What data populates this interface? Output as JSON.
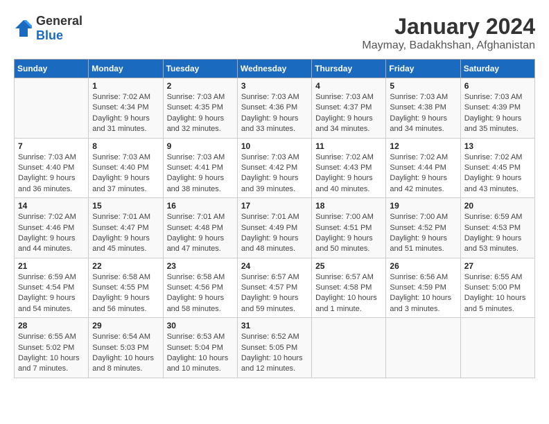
{
  "header": {
    "logo_general": "General",
    "logo_blue": "Blue",
    "month_title": "January 2024",
    "location": "Maymay, Badakhshan, Afghanistan"
  },
  "weekdays": [
    "Sunday",
    "Monday",
    "Tuesday",
    "Wednesday",
    "Thursday",
    "Friday",
    "Saturday"
  ],
  "weeks": [
    [
      {
        "day": "",
        "info": ""
      },
      {
        "day": "1",
        "info": "Sunrise: 7:02 AM\nSunset: 4:34 PM\nDaylight: 9 hours\nand 31 minutes."
      },
      {
        "day": "2",
        "info": "Sunrise: 7:03 AM\nSunset: 4:35 PM\nDaylight: 9 hours\nand 32 minutes."
      },
      {
        "day": "3",
        "info": "Sunrise: 7:03 AM\nSunset: 4:36 PM\nDaylight: 9 hours\nand 33 minutes."
      },
      {
        "day": "4",
        "info": "Sunrise: 7:03 AM\nSunset: 4:37 PM\nDaylight: 9 hours\nand 34 minutes."
      },
      {
        "day": "5",
        "info": "Sunrise: 7:03 AM\nSunset: 4:38 PM\nDaylight: 9 hours\nand 34 minutes."
      },
      {
        "day": "6",
        "info": "Sunrise: 7:03 AM\nSunset: 4:39 PM\nDaylight: 9 hours\nand 35 minutes."
      }
    ],
    [
      {
        "day": "7",
        "info": "Sunrise: 7:03 AM\nSunset: 4:40 PM\nDaylight: 9 hours\nand 36 minutes."
      },
      {
        "day": "8",
        "info": "Sunrise: 7:03 AM\nSunset: 4:40 PM\nDaylight: 9 hours\nand 37 minutes."
      },
      {
        "day": "9",
        "info": "Sunrise: 7:03 AM\nSunset: 4:41 PM\nDaylight: 9 hours\nand 38 minutes."
      },
      {
        "day": "10",
        "info": "Sunrise: 7:03 AM\nSunset: 4:42 PM\nDaylight: 9 hours\nand 39 minutes."
      },
      {
        "day": "11",
        "info": "Sunrise: 7:02 AM\nSunset: 4:43 PM\nDaylight: 9 hours\nand 40 minutes."
      },
      {
        "day": "12",
        "info": "Sunrise: 7:02 AM\nSunset: 4:44 PM\nDaylight: 9 hours\nand 42 minutes."
      },
      {
        "day": "13",
        "info": "Sunrise: 7:02 AM\nSunset: 4:45 PM\nDaylight: 9 hours\nand 43 minutes."
      }
    ],
    [
      {
        "day": "14",
        "info": "Sunrise: 7:02 AM\nSunset: 4:46 PM\nDaylight: 9 hours\nand 44 minutes."
      },
      {
        "day": "15",
        "info": "Sunrise: 7:01 AM\nSunset: 4:47 PM\nDaylight: 9 hours\nand 45 minutes."
      },
      {
        "day": "16",
        "info": "Sunrise: 7:01 AM\nSunset: 4:48 PM\nDaylight: 9 hours\nand 47 minutes."
      },
      {
        "day": "17",
        "info": "Sunrise: 7:01 AM\nSunset: 4:49 PM\nDaylight: 9 hours\nand 48 minutes."
      },
      {
        "day": "18",
        "info": "Sunrise: 7:00 AM\nSunset: 4:51 PM\nDaylight: 9 hours\nand 50 minutes."
      },
      {
        "day": "19",
        "info": "Sunrise: 7:00 AM\nSunset: 4:52 PM\nDaylight: 9 hours\nand 51 minutes."
      },
      {
        "day": "20",
        "info": "Sunrise: 6:59 AM\nSunset: 4:53 PM\nDaylight: 9 hours\nand 53 minutes."
      }
    ],
    [
      {
        "day": "21",
        "info": "Sunrise: 6:59 AM\nSunset: 4:54 PM\nDaylight: 9 hours\nand 54 minutes."
      },
      {
        "day": "22",
        "info": "Sunrise: 6:58 AM\nSunset: 4:55 PM\nDaylight: 9 hours\nand 56 minutes."
      },
      {
        "day": "23",
        "info": "Sunrise: 6:58 AM\nSunset: 4:56 PM\nDaylight: 9 hours\nand 58 minutes."
      },
      {
        "day": "24",
        "info": "Sunrise: 6:57 AM\nSunset: 4:57 PM\nDaylight: 9 hours\nand 59 minutes."
      },
      {
        "day": "25",
        "info": "Sunrise: 6:57 AM\nSunset: 4:58 PM\nDaylight: 10 hours\nand 1 minute."
      },
      {
        "day": "26",
        "info": "Sunrise: 6:56 AM\nSunset: 4:59 PM\nDaylight: 10 hours\nand 3 minutes."
      },
      {
        "day": "27",
        "info": "Sunrise: 6:55 AM\nSunset: 5:00 PM\nDaylight: 10 hours\nand 5 minutes."
      }
    ],
    [
      {
        "day": "28",
        "info": "Sunrise: 6:55 AM\nSunset: 5:02 PM\nDaylight: 10 hours\nand 7 minutes."
      },
      {
        "day": "29",
        "info": "Sunrise: 6:54 AM\nSunset: 5:03 PM\nDaylight: 10 hours\nand 8 minutes."
      },
      {
        "day": "30",
        "info": "Sunrise: 6:53 AM\nSunset: 5:04 PM\nDaylight: 10 hours\nand 10 minutes."
      },
      {
        "day": "31",
        "info": "Sunrise: 6:52 AM\nSunset: 5:05 PM\nDaylight: 10 hours\nand 12 minutes."
      },
      {
        "day": "",
        "info": ""
      },
      {
        "day": "",
        "info": ""
      },
      {
        "day": "",
        "info": ""
      }
    ]
  ]
}
